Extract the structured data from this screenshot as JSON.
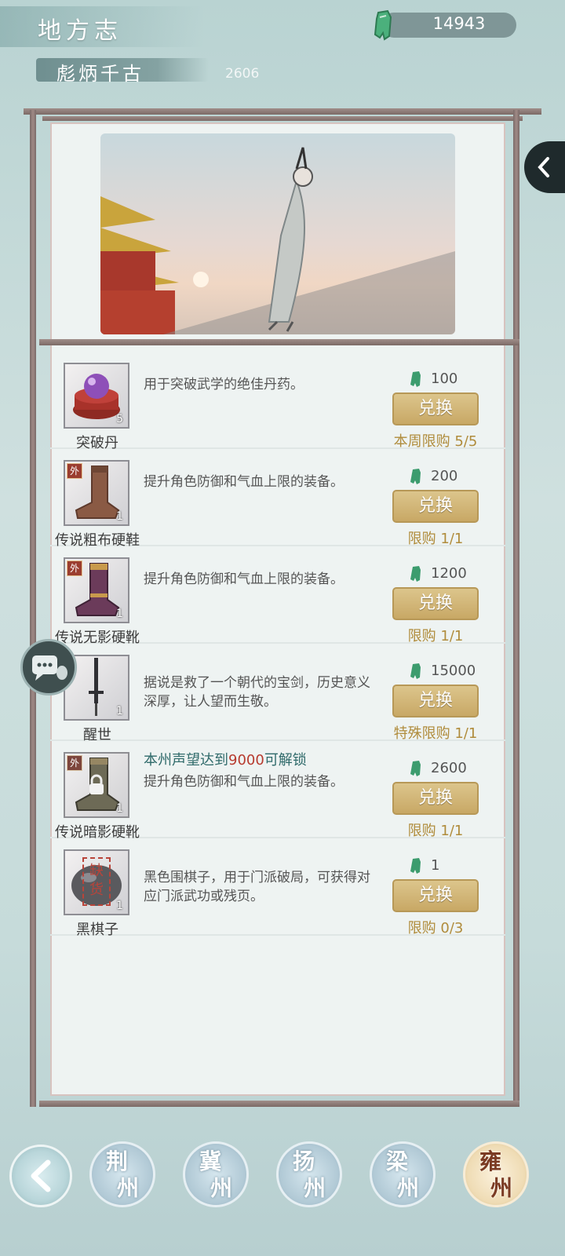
{
  "header": {
    "title": "地方志",
    "subtitle": "彪炳千古",
    "subtitle_count": "2606",
    "currency_icon": "jade-coin-icon",
    "currency_value": "14943"
  },
  "items": [
    {
      "name": "突破丹",
      "qty": "5",
      "tag": "",
      "icon": "breakthrough-pill-icon",
      "description": "用于突破武学的绝佳丹药。",
      "unlock": "",
      "price": "100",
      "button": "兑换",
      "limit": "本周限购 5/5"
    },
    {
      "name": "传说粗布硬鞋",
      "qty": "1",
      "tag": "外",
      "icon": "cloth-boot-icon",
      "description": "提升角色防御和气血上限的装备。",
      "unlock": "",
      "price": "200",
      "button": "兑换",
      "limit": "限购 1/1"
    },
    {
      "name": "传说无影硬靴",
      "qty": "1",
      "tag": "外",
      "icon": "purple-boot-icon",
      "description": "提升角色防御和气血上限的装备。",
      "unlock": "",
      "price": "1200",
      "button": "兑换",
      "limit": "限购 1/1"
    },
    {
      "name": "醒世",
      "qty": "1",
      "tag": "",
      "icon": "sword-icon",
      "description": "据说是救了一个朝代的宝剑，历史意义深厚，让人望而生敬。",
      "unlock": "",
      "price": "15000",
      "button": "兑换",
      "limit": "特殊限购 1/1"
    },
    {
      "name": "传说暗影硬靴",
      "qty": "1",
      "tag": "外",
      "icon": "shadow-boot-icon",
      "description": "提升角色防御和气血上限的装备。",
      "unlock_prefix": "本州声望达到",
      "unlock_num": "9000",
      "unlock_suffix": "可解锁",
      "price": "2600",
      "button": "兑换",
      "limit": "限购 1/1"
    },
    {
      "name": "黑棋子",
      "qty": "1",
      "tag": "",
      "icon": "black-go-stone-icon",
      "stamp": "缺货",
      "description": "黑色围棋子，用于门派破局，可获得对应门派武功或残页。",
      "unlock": "",
      "price": "1",
      "button": "兑换",
      "limit": "限购 0/3"
    }
  ],
  "nav": {
    "back_icon": "back-arrow-icon",
    "regions": [
      {
        "label": "荆州",
        "active": false
      },
      {
        "label": "冀州",
        "active": false
      },
      {
        "label": "扬州",
        "active": false
      },
      {
        "label": "梁州",
        "active": false
      },
      {
        "label": "雍州",
        "active": true
      }
    ]
  },
  "side": {
    "collapse_icon": "chevron-left-icon",
    "chat_icon": "chat-bubble-icon"
  },
  "colors": {
    "button_gold": "#c8a865",
    "limit_gold": "#b08c3c",
    "jade_green": "#3c9c6e",
    "unlock_red": "#b73b2f"
  }
}
